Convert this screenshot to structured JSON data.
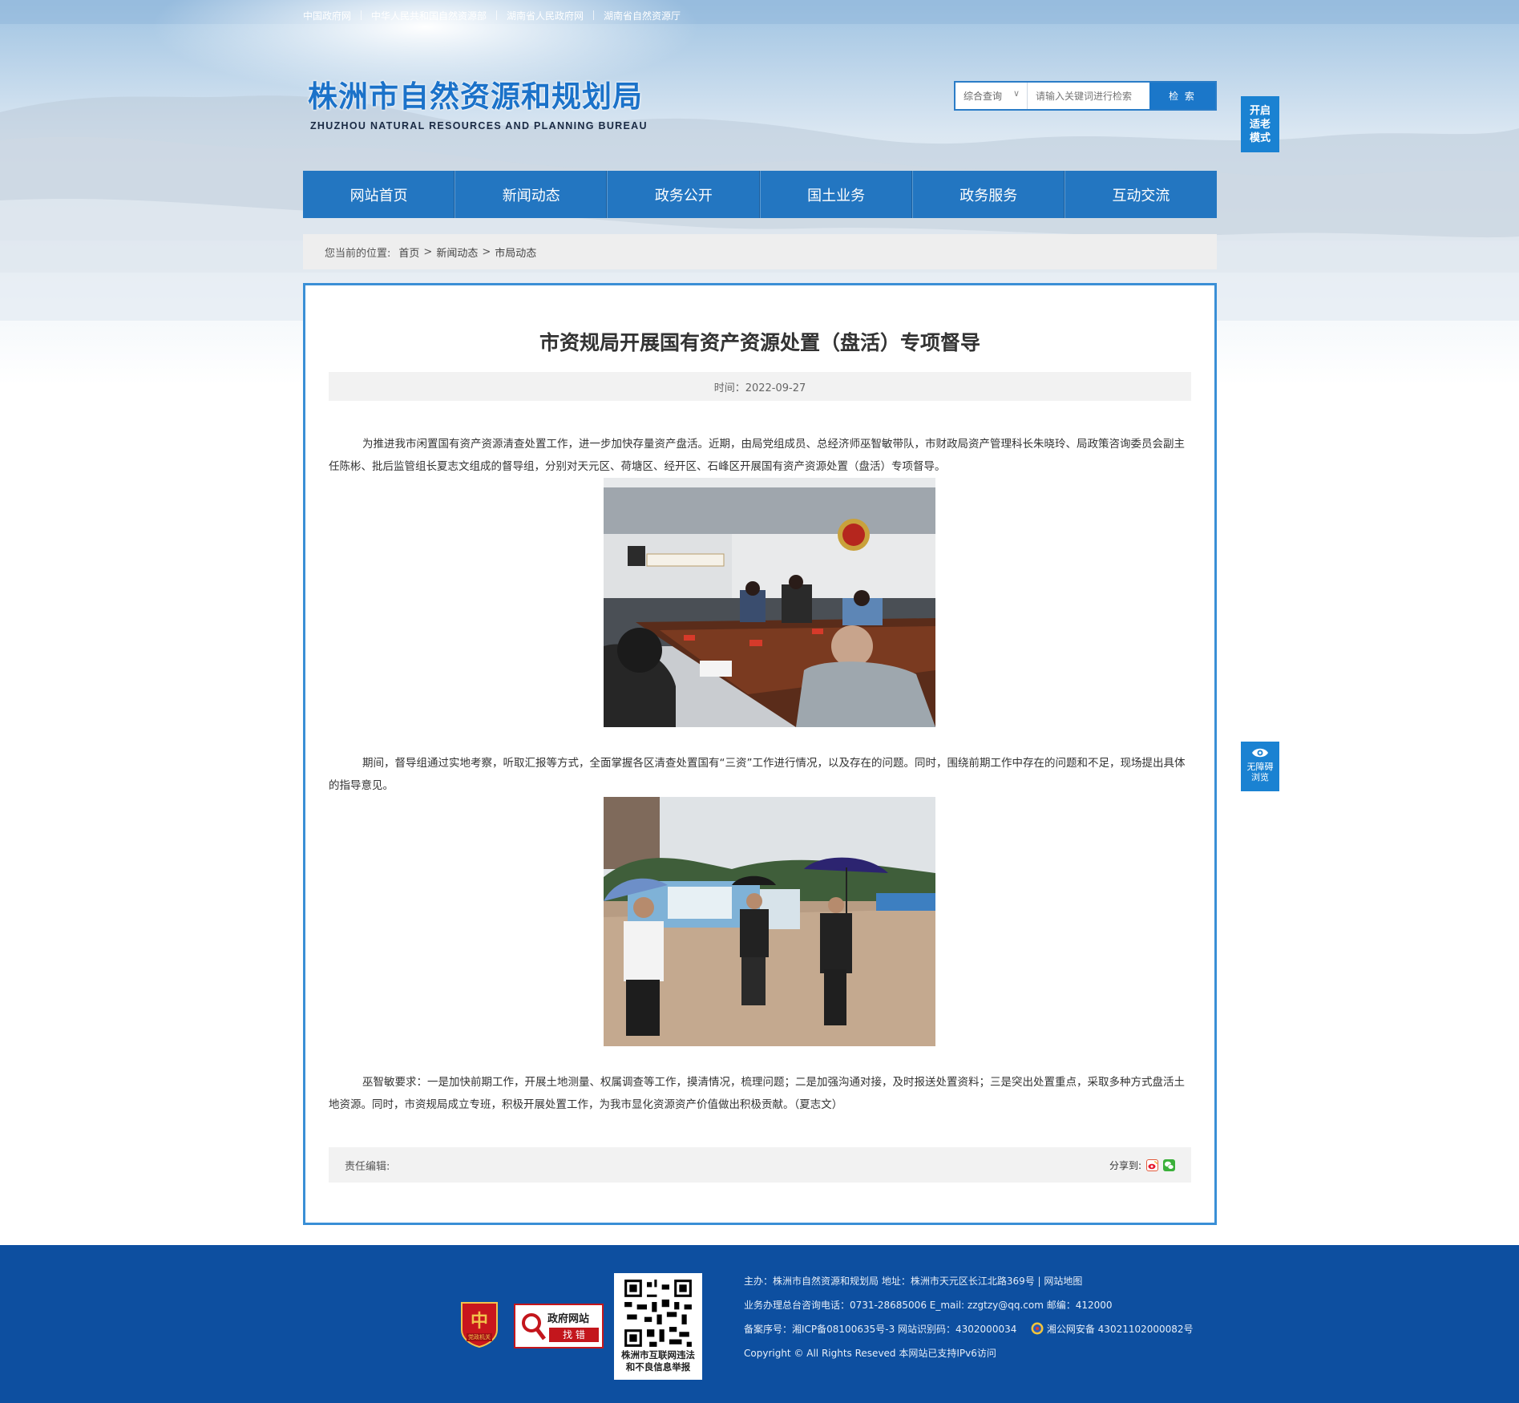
{
  "top_links": [
    "中国政府网",
    "中华人民共和国自然资源部",
    "湖南省人民政府网",
    "湖南省自然资源厅"
  ],
  "logo": {
    "cn": "株洲市自然资源和规划局",
    "en": "ZHUZHOU NATURAL RESOURCES AND PLANNING BUREAU"
  },
  "search": {
    "scope": "综合查询",
    "placeholder": "请输入关键词进行检索",
    "button": "检 索"
  },
  "side": {
    "elder_mode": "开启适老模式",
    "elder_lines": [
      "开启",
      "适老",
      "模式"
    ],
    "accessible_lines": [
      "无障碍",
      "浏览"
    ]
  },
  "nav": [
    "网站首页",
    "新闻动态",
    "政务公开",
    "国土业务",
    "政务服务",
    "互动交流"
  ],
  "breadcrumb": {
    "label": "您当前的位置:",
    "items": [
      "首页",
      "新闻动态",
      "市局动态"
    ],
    "sep": ">"
  },
  "article": {
    "title": "市资规局开展国有资产资源处置（盘活）专项督导",
    "date_text": "时间：2022-09-27",
    "paragraphs": [
      "为推进我市闲置国有资产资源清查处置工作，进一步加快存量资产盘活。近期，由局党组成员、总经济师巫智敏带队，市财政局资产管理科长朱晓玲、局政策咨询委员会副主任陈彬、批后监管组长夏志文组成的督导组，分别对天元区、荷塘区、经开区、石峰区开展国有资产资源处置（盘活）专项督导。",
      "期间，督导组通过实地考察，听取汇报等方式，全面掌握各区清查处置国有“三资”工作进行情况，以及存在的问题。同时，围绕前期工作中存在的问题和不足，现场提出具体的指导意见。",
      "巫智敏要求：一是加快前期工作，开展土地测量、权属调查等工作，摸清情况，梳理问题；二是加强沟通对接，及时报送处置资料；三是突出处置重点，采取多种方式盘活土地资源。同时，市资规局成立专班，积极开展处置工作，为我市显化资源资产价值做出积极贡献。（夏志文）"
    ],
    "editor_label": "责任编辑:",
    "share_label": "分享到:"
  },
  "footer": {
    "badge_text": "党政机关",
    "zhaocuo_top": "政府网站",
    "zhaocuo_bottom": "找 错",
    "qr_caption_1": "株洲市互联网违法",
    "qr_caption_2": "和不良信息举报",
    "line1": "主办：株洲市自然资源和规划局   地址：株洲市天元区长江北路369号  |  网站地图",
    "line2": "业务办理总台咨询电话：0731-28685006    E_mail:   zzgtzy@qq.com     邮编：412000",
    "line3a": "备案序号：湘ICP备08100635号-3 网站识别码：4302000034",
    "line3b": "湘公网安备 43021102000082号",
    "line4": "Copyright © All Rights Reseved 本网站已支持IPv6访问"
  },
  "colors": {
    "nav_blue": "#2376c1",
    "border_blue": "#3a8fd6",
    "footer_blue": "#0d4fa0",
    "side_blue": "#1a82d2"
  }
}
